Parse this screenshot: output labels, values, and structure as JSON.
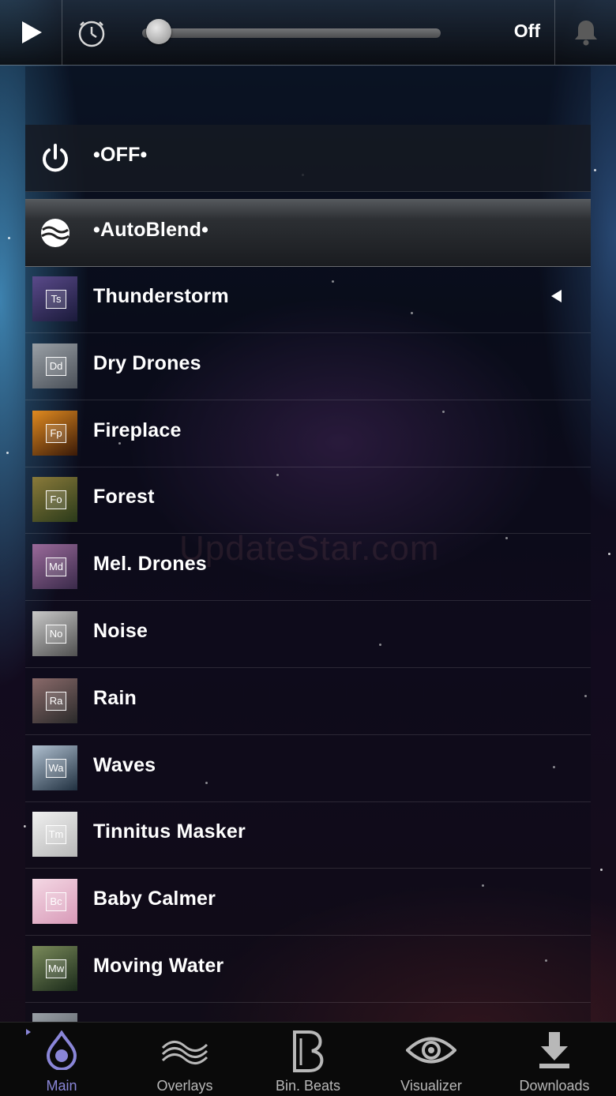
{
  "topbar": {
    "play_icon": "play-icon",
    "timer_icon": "timer-icon",
    "volume_fraction": 0.02,
    "status": "Off",
    "alarm_icon": "bell-icon"
  },
  "system_rows": [
    {
      "label": "•OFF•",
      "icon": "power-icon"
    },
    {
      "label": "•AutoBlend•",
      "icon": "autoblend-icon"
    }
  ],
  "sounds": [
    {
      "label": "Thunderstorm",
      "abbr": "Ts",
      "colors": [
        "#5a4a8a",
        "#1a1a3a"
      ],
      "selected": true
    },
    {
      "label": "Dry Drones",
      "abbr": "Dd",
      "colors": [
        "#9aa0a6",
        "#4a5058"
      ]
    },
    {
      "label": "Fireplace",
      "abbr": "Fp",
      "colors": [
        "#e08a20",
        "#3a1a08"
      ]
    },
    {
      "label": "Forest",
      "abbr": "Fo",
      "colors": [
        "#8a7a3a",
        "#2a3a1a"
      ]
    },
    {
      "label": "Mel. Drones",
      "abbr": "Md",
      "colors": [
        "#9a6a9a",
        "#3a2a4a"
      ]
    },
    {
      "label": "Noise",
      "abbr": "No",
      "colors": [
        "#c8c8c8",
        "#505050"
      ]
    },
    {
      "label": "Rain",
      "abbr": "Ra",
      "colors": [
        "#8a6a6a",
        "#2a2a2a"
      ]
    },
    {
      "label": "Waves",
      "abbr": "Wa",
      "colors": [
        "#b0c0d0",
        "#203040"
      ]
    },
    {
      "label": "Tinnitus Masker",
      "abbr": "Tm",
      "colors": [
        "#f0f0f0",
        "#b8b8b8"
      ]
    },
    {
      "label": "Baby Calmer",
      "abbr": "Bc",
      "colors": [
        "#f4d8e4",
        "#d89ab8"
      ]
    },
    {
      "label": "Moving Water",
      "abbr": "Mw",
      "colors": [
        "#7a8a5a",
        "#1a2a1a"
      ]
    },
    {
      "label": "",
      "abbr": "",
      "colors": [
        "#9aa0a6",
        "#4a5058"
      ]
    }
  ],
  "watermark": "UpdateStar.com",
  "tabs": [
    {
      "label": "Main",
      "icon": "drop-icon",
      "selected": true
    },
    {
      "label": "Overlays",
      "icon": "waves-icon"
    },
    {
      "label": "Bin. Beats",
      "icon": "binaural-beats-icon"
    },
    {
      "label": "Visualizer",
      "icon": "eye-icon"
    },
    {
      "label": "Downloads",
      "icon": "download-icon"
    }
  ],
  "colors": {
    "accent": "#8a86d8",
    "tab_inactive": "#b8b8b8"
  }
}
